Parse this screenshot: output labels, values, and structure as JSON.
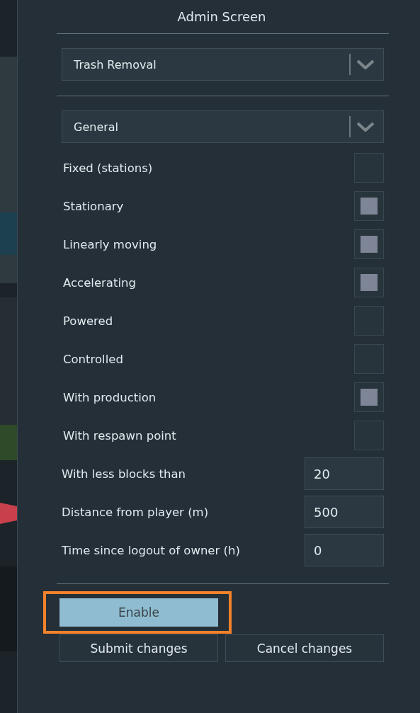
{
  "window": {
    "title": "Admin Screen"
  },
  "dropdowns": [
    {
      "value": "Trash Removal"
    },
    {
      "value": "General"
    }
  ],
  "options": [
    {
      "kind": "checkbox",
      "label": "Fixed (stations)",
      "checked": false
    },
    {
      "kind": "checkbox",
      "label": "Stationary",
      "checked": true
    },
    {
      "kind": "checkbox",
      "label": "Linearly moving",
      "checked": true
    },
    {
      "kind": "checkbox",
      "label": "Accelerating",
      "checked": true
    },
    {
      "kind": "checkbox",
      "label": "Powered",
      "checked": false
    },
    {
      "kind": "checkbox",
      "label": "Controlled",
      "checked": false
    },
    {
      "kind": "checkbox",
      "label": "With production",
      "checked": true
    },
    {
      "kind": "checkbox",
      "label": "With respawn point",
      "checked": false
    },
    {
      "kind": "number",
      "label": "With less blocks than",
      "value": "20"
    },
    {
      "kind": "number",
      "label": "Distance from player (m)",
      "value": "500"
    },
    {
      "kind": "number",
      "label": "Time since logout of owner (h)",
      "value": "0"
    }
  ],
  "enable_button": {
    "label": "Enable",
    "highlighted": true
  },
  "buttons": [
    {
      "label": "Submit changes"
    },
    {
      "label": "Cancel changes"
    }
  ]
}
